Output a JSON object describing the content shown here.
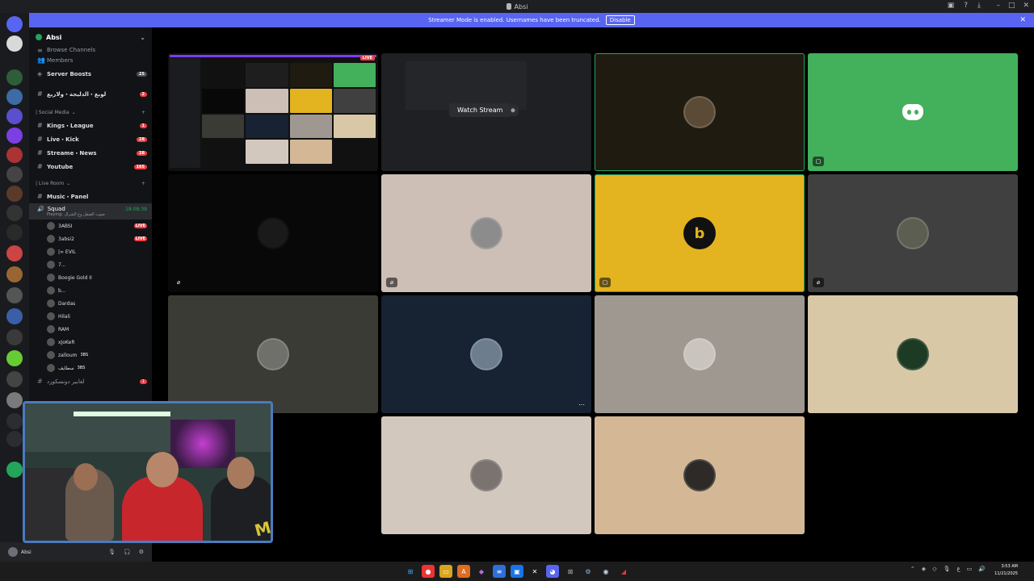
{
  "window": {
    "title": "Absi"
  },
  "banner": {
    "text": "Streamer Mode is enabled. Usernames have been truncated.",
    "button": "Disable"
  },
  "guild": {
    "name": "Absi"
  },
  "channels": {
    "browse": "Browse Channels",
    "members": "Members",
    "boosts": "Server Boosts",
    "boosts_count": "25",
    "arabic_channel": "لوبغ・الدليجة・ولاريع",
    "arabic_count": "2",
    "social_category": "| Social Media",
    "kings": "Kings・League",
    "kings_count": "1",
    "live_kick": "Live・Kick",
    "live_kick_count": "28",
    "streame_news": "Streame・News",
    "streame_news_count": "28",
    "youtube": "Youtube",
    "youtube_count": "165",
    "live_room_category": "| Live Room",
    "music_panel": "Music・Panel",
    "squad": "Squad",
    "squad_time": "18:08:39",
    "squad_playing": "Playing: صوت الضقل وع الشرال",
    "voice_users": [
      {
        "name": "3ABSI",
        "badge": "LIVE"
      },
      {
        "name": "3absi2",
        "badge": "LIVE"
      },
      {
        "name": "|∞ EVIL",
        "badge": ""
      },
      {
        "name": "7...",
        "badge": ""
      },
      {
        "name": "Boogie Gold II",
        "badge": ""
      },
      {
        "name": "b...",
        "badge": ""
      },
      {
        "name": "Dardas",
        "badge": ""
      },
      {
        "name": "Hilali",
        "badge": ""
      },
      {
        "name": "RAM",
        "badge": ""
      },
      {
        "name": "xJoKeR",
        "badge": ""
      },
      {
        "name": "zalloum",
        "badge": "3BS"
      },
      {
        "name": "سطايف",
        "badge": "3BS"
      }
    ],
    "last_channel": "لغابير دونسكورد",
    "last_count": "1"
  },
  "user_bar": {
    "name": "Absi"
  },
  "stage": {
    "live_badge": "LIVE",
    "watch_label": "Watch Stream"
  },
  "taskbar": {
    "time": "3:53 AM",
    "date": "11/21/2025"
  },
  "colors": {
    "accent": "#5865f2",
    "green_tile": "#43b05c",
    "yellow_tile": "#e3b320",
    "live_red": "#f23f42"
  }
}
